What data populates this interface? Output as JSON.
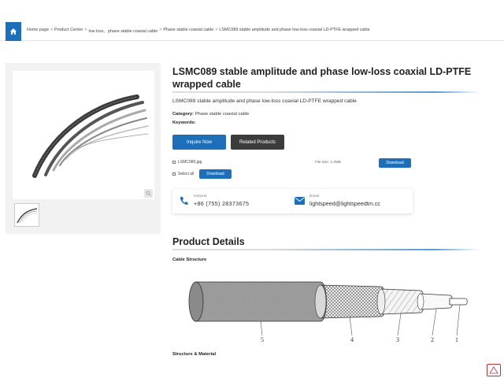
{
  "breadcrumb": {
    "items": [
      "Home page",
      "Product Center",
      "low loss、phase stable coaxial cable",
      "Phase stable coaxial cable",
      "LSMC089 stable amplitude and phase low-loss coaxial LD-PTFE wrapped cable"
    ],
    "separator": ">"
  },
  "product": {
    "title": "LSMC089 stable amplitude and phase low-loss coaxial LD-PTFE wrapped cable",
    "subtitle": "LSMC089 stable amplitude and phase low-loss coaxial LD-PTFE wrapped cable",
    "category_label": "Category:",
    "category_value": "Phase stable coaxial cable",
    "keywords_label": "Keywords:"
  },
  "buttons": {
    "inquire": "Inquire Now",
    "related": "Related Products",
    "download": "Download",
    "download2": "Download"
  },
  "files": {
    "filename": "LSMC089.jpg",
    "filesize": "File size: 1.2MB",
    "select_all": "Select all"
  },
  "contact": {
    "hotline_label": "HotLine",
    "hotline_value": "+86  (755)  28373675",
    "email_label": "Email",
    "email_value": "lightspeed@lightspeedtm.cc"
  },
  "details": {
    "title": "Product Details",
    "cable_structure": "Cable Structure",
    "structure_material": "Structure & Material",
    "diagram_labels": [
      "5",
      "4",
      "3",
      "2",
      "1"
    ]
  },
  "colors": {
    "accent": "#1e6fba",
    "dark_button": "#3c3c3c"
  }
}
